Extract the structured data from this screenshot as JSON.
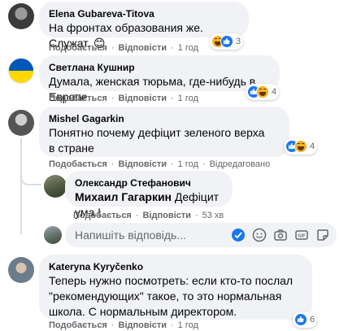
{
  "comments": [
    {
      "author": "Elena Gubareva-Titova",
      "text": "На фронтах образования же. Служат. 😊",
      "actions": {
        "like": "Подобається",
        "reply": "Відповісти",
        "time": "1 год"
      },
      "reactions": {
        "types": [
          "haha",
          "like"
        ],
        "count": "3"
      }
    },
    {
      "author": "Светлана Кушнир",
      "text": "Думала, женская тюрьма, где-нибудь в Европе.",
      "actions": {
        "like": "Подобається",
        "reply": "Відповісти",
        "time": "1 год"
      },
      "reactions": {
        "types": [
          "like",
          "haha"
        ],
        "count": "4"
      }
    },
    {
      "author": "Mishel Gagarkin",
      "text": "Понятно почему дефіцит зеленого верха в стране",
      "actions": {
        "like": "Подобається",
        "reply": "Відповісти",
        "time": "1 год",
        "edited": "Відредаговано"
      },
      "reactions": {
        "types": [
          "like",
          "haha"
        ],
        "count": "4"
      }
    },
    {
      "author": "Kateryna Kyryčenko",
      "text": "Теперь нужно посмотреть: если кто-то послал \"рекомендующих\" такое, то это нормальная школа. С нормальным директором.",
      "actions": {
        "like": "Подобається",
        "reply": "Відповісти",
        "time": "1 год"
      },
      "reactions": {
        "types": [
          "like"
        ],
        "count": "6"
      }
    }
  ],
  "reply": {
    "author": "Олександр Стефанович",
    "mention": "Михаил Гагаркин",
    "text": " Дефіцит ума !",
    "actions": {
      "like": "Подобається",
      "reply": "Відповісти",
      "time": "53 хв"
    }
  },
  "reply_input": {
    "placeholder": "Напишіть відповідь..."
  },
  "colors": {
    "bubble": "#f0f2f5",
    "meta_text": "#65676b",
    "like_blue": "#1877f2",
    "haha_yellow": "#f7b125"
  }
}
